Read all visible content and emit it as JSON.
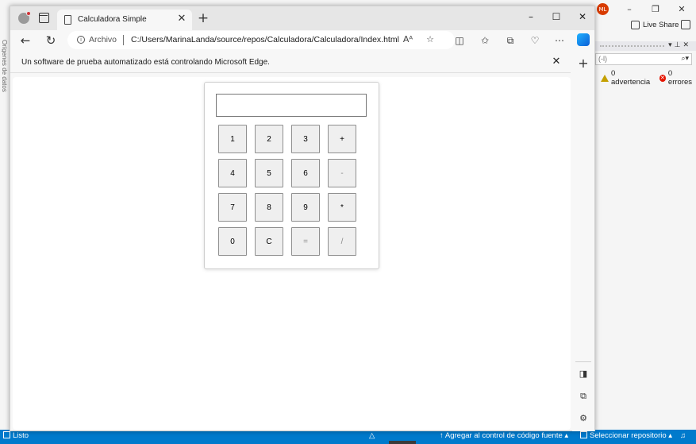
{
  "browser": {
    "tab_title": "Calculadora Simple",
    "omnibox_label": "Archivo",
    "url": "C:/Users/MarinaLanda/source/repos/Calculadora/Calculadora/Index.html",
    "read_aloud_glyph": "A̩",
    "infobar_message": "Un software de prueba automatizado está controlando Microsoft Edge."
  },
  "calculator": {
    "display_value": "",
    "buttons": [
      "1",
      "2",
      "3",
      "+",
      "4",
      "5",
      "6",
      "-",
      "7",
      "8",
      "9",
      "*",
      "0",
      "C",
      "=",
      "/"
    ]
  },
  "vs": {
    "avatar_initials": "ML",
    "live_share": "Live Share",
    "filter_text": "(-l)",
    "warnings": "0 advertencia",
    "errors": "0 errores",
    "left_vertical_text": "Orígenes de datos",
    "status": {
      "ready": "Listo",
      "source_control": "Agregar al control de código fuente",
      "select_repo": "Seleccionar repositorio"
    }
  },
  "colors": {
    "status_bar": "#007acc",
    "avatar": "#d83b01"
  }
}
